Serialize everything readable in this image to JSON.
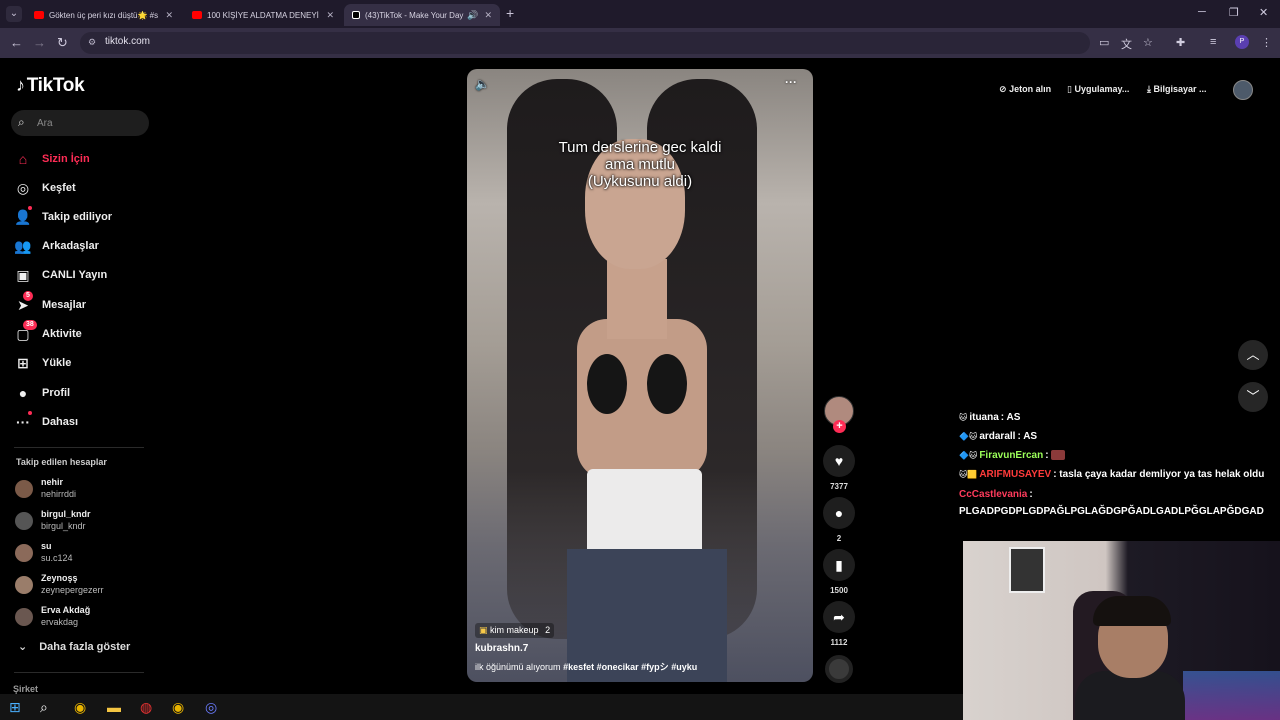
{
  "browser": {
    "tabs": [
      {
        "title": "Gökten üç peri kızı düştü🌟 #s",
        "icon_color": "#ff0000"
      },
      {
        "title": "100 KİŞİYE ALDATMA DENEYİ -",
        "icon_color": "#ff0000"
      },
      {
        "title": "(43)TikTok - Make Your Day",
        "icon_color": "#ffffff"
      }
    ],
    "new_tab": "+",
    "url": "tiktok.com",
    "profile_initial": "P",
    "window_controls": [
      "─",
      "❐",
      "✕"
    ],
    "nav_icons": [
      "arrow-left-icon",
      "arrow-right-icon",
      "reload-icon"
    ]
  },
  "sidebar": {
    "logo": "TikTok",
    "search_placeholder": "Ara",
    "nav": [
      {
        "label": "Sizin İçin",
        "icon": "home-icon",
        "glyph": "⌂",
        "active": true
      },
      {
        "label": "Keşfet",
        "icon": "compass-icon",
        "glyph": "◎"
      },
      {
        "label": "Takip ediliyor",
        "icon": "following-icon",
        "glyph": "👤"
      },
      {
        "label": "Arkadaşlar",
        "icon": "friends-icon",
        "glyph": "👥"
      },
      {
        "label": "CANLI Yayın",
        "icon": "live-icon",
        "glyph": "▣"
      },
      {
        "label": "Mesajlar",
        "icon": "messages-icon",
        "glyph": "➤",
        "badge": "5"
      },
      {
        "label": "Aktivite",
        "icon": "activity-icon",
        "glyph": "▢",
        "badge": "38"
      },
      {
        "label": "Yükle",
        "icon": "upload-icon",
        "glyph": "⊞"
      },
      {
        "label": "Profil",
        "icon": "profile-icon",
        "glyph": "●"
      },
      {
        "label": "Dahası",
        "icon": "more-icon",
        "glyph": "···"
      }
    ],
    "following_title": "Takip edilen hesaplar",
    "following": [
      {
        "name": "nehir",
        "handle": "nehirrddi"
      },
      {
        "name": "birgul_kndr",
        "handle": "birgul_kndr"
      },
      {
        "name": "su",
        "handle": "su.c124"
      },
      {
        "name": "Zeynoşş",
        "handle": "zeynepergezerr"
      },
      {
        "name": "Erva Akdağ",
        "handle": "ervakdag"
      }
    ],
    "show_more": "Daha fazla göster",
    "company": "Şirket"
  },
  "video": {
    "caption_lines": [
      "Tum derslerine gec kaldi",
      "ama mutlu",
      "(Uykusunu aldi)"
    ],
    "effect": "kim makeup",
    "effect_count": "2",
    "author": "kubrashn.7",
    "description": "ilk öğünümü alıyorum",
    "hashtags": [
      "#kesfet",
      "#onecikar",
      "#fypシ",
      "#uyku"
    ]
  },
  "actions": {
    "likes": "7377",
    "comments": "2",
    "saves": "1500",
    "shares": "1112"
  },
  "topright": {
    "coins": "Jeton alın",
    "app": "Uygulamay...",
    "pc": "Bilgisayar ..."
  },
  "chat": [
    {
      "user": "ituana",
      "color": "#ffffff",
      "badge": "🐱",
      "message": "AS"
    },
    {
      "user": "ardarall",
      "color": "#ffffff",
      "badge": "🔷🐱",
      "message": "AS"
    },
    {
      "user": "FiravunErcan",
      "color": "#9cff5a",
      "badge": "🔷🐱",
      "message": ""
    },
    {
      "user": "ARIFMUSAYEV",
      "color": "#ff3b3b",
      "badge": "🐱🟨",
      "message": "tasla çaya kadar demliyor ya tas helak oldu"
    },
    {
      "user": "CcCastlevania",
      "color": "#ff3b5c",
      "badge": "",
      "message": ""
    },
    {
      "user": "",
      "color": "#ffffff",
      "badge": "",
      "message": "PLGADPGDPLGDPAĞLPGLAĞDGPĞADLGADLPĞGLAPĞDGAD"
    }
  ],
  "colors": {
    "accent": "#fe2c55",
    "chrome_bg": "#1f1a2b",
    "page_bg": "#000000"
  }
}
